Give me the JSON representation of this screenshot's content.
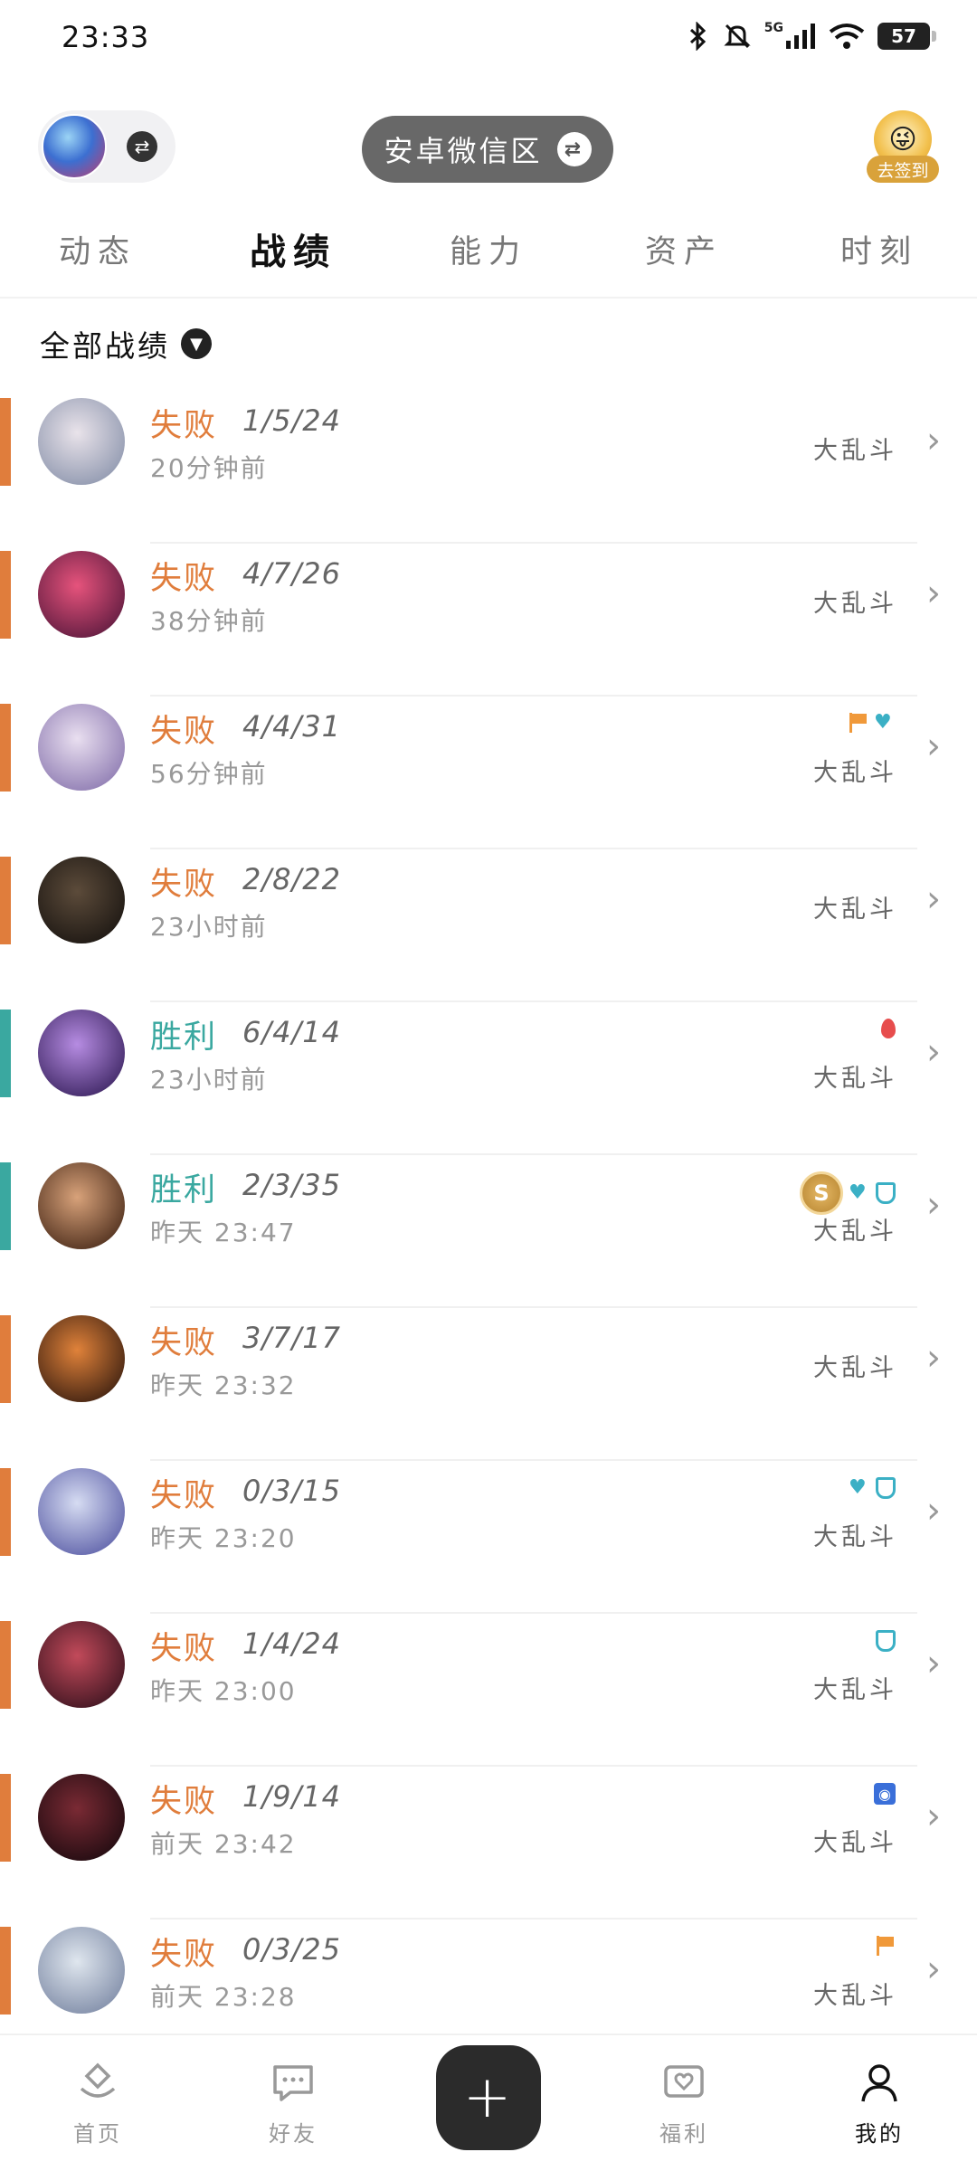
{
  "status_bar": {
    "time": "23:33",
    "battery": "57",
    "network": "5G"
  },
  "header": {
    "server_name": "安卓微信区",
    "checkin_label": "去签到"
  },
  "tabs": [
    {
      "label": "动态"
    },
    {
      "label": "战绩",
      "active": true
    },
    {
      "label": "能力"
    },
    {
      "label": "资产"
    },
    {
      "label": "时刻"
    }
  ],
  "filter": {
    "label": "全部战绩"
  },
  "colors": {
    "loss": "#e07d3c",
    "win": "#3aa8a0"
  },
  "matches": [
    {
      "result": "失败",
      "outcome": "loss",
      "kda": "1/5/24",
      "time": "20分钟前",
      "mode": "大乱斗",
      "badges": [],
      "avatar_colors": [
        "#e9e3ea",
        "#8c95ad"
      ]
    },
    {
      "result": "失败",
      "outcome": "loss",
      "kda": "4/7/26",
      "time": "38分钟前",
      "mode": "大乱斗",
      "badges": [],
      "avatar_colors": [
        "#e6537c",
        "#5b1a3e"
      ]
    },
    {
      "result": "失败",
      "outcome": "loss",
      "kda": "4/4/31",
      "time": "56分钟前",
      "mode": "大乱斗",
      "badges": [
        "flag-icon",
        "heart-icon"
      ],
      "avatar_colors": [
        "#e9dff0",
        "#8b78b0"
      ]
    },
    {
      "result": "失败",
      "outcome": "loss",
      "kda": "2/8/22",
      "time": "23小时前",
      "mode": "大乱斗",
      "badges": [],
      "avatar_colors": [
        "#5c4b3a",
        "#1b1612"
      ]
    },
    {
      "result": "胜利",
      "outcome": "win",
      "kda": "6/4/14",
      "time": "23小时前",
      "mode": "大乱斗",
      "badges": [
        "blood-icon"
      ],
      "avatar_colors": [
        "#b68ce2",
        "#3a2360"
      ]
    },
    {
      "result": "胜利",
      "outcome": "win",
      "kda": "2/3/35",
      "time": "昨天 23:47",
      "mode": "大乱斗",
      "badges": [
        "mvp-icon",
        "heart-icon",
        "shield-icon"
      ],
      "avatar_colors": [
        "#d8a27a",
        "#4a2b1a"
      ]
    },
    {
      "result": "失败",
      "outcome": "loss",
      "kda": "3/7/17",
      "time": "昨天 23:32",
      "mode": "大乱斗",
      "badges": [],
      "avatar_colors": [
        "#e0823a",
        "#3a1e10"
      ]
    },
    {
      "result": "失败",
      "outcome": "loss",
      "kda": "0/3/15",
      "time": "昨天 23:20",
      "mode": "大乱斗",
      "badges": [
        "heart-icon",
        "shield-icon"
      ],
      "avatar_colors": [
        "#d6dcf2",
        "#5c5fa8"
      ]
    },
    {
      "result": "失败",
      "outcome": "loss",
      "kda": "1/4/24",
      "time": "昨天 23:00",
      "mode": "大乱斗",
      "badges": [
        "shield-icon"
      ],
      "avatar_colors": [
        "#c24a5a",
        "#3b1420"
      ]
    },
    {
      "result": "失败",
      "outcome": "loss",
      "kda": "1/9/14",
      "time": "前天 23:42",
      "mode": "大乱斗",
      "badges": [
        "vision-icon"
      ],
      "avatar_colors": [
        "#7a2a34",
        "#1e0b10"
      ]
    },
    {
      "result": "失败",
      "outcome": "loss",
      "kda": "0/3/25",
      "time": "前天 23:28",
      "mode": "大乱斗",
      "badges": [
        "flag-icon"
      ],
      "avatar_colors": [
        "#dfe6ee",
        "#7d8aa6"
      ]
    }
  ],
  "bottom_nav": [
    {
      "label": "首页",
      "icon": "home-icon"
    },
    {
      "label": "好友",
      "icon": "chat-icon"
    },
    {
      "label": "",
      "icon": "plus-icon"
    },
    {
      "label": "福利",
      "icon": "gift-heart-icon"
    },
    {
      "label": "我的",
      "icon": "profile-icon",
      "active": true
    }
  ]
}
